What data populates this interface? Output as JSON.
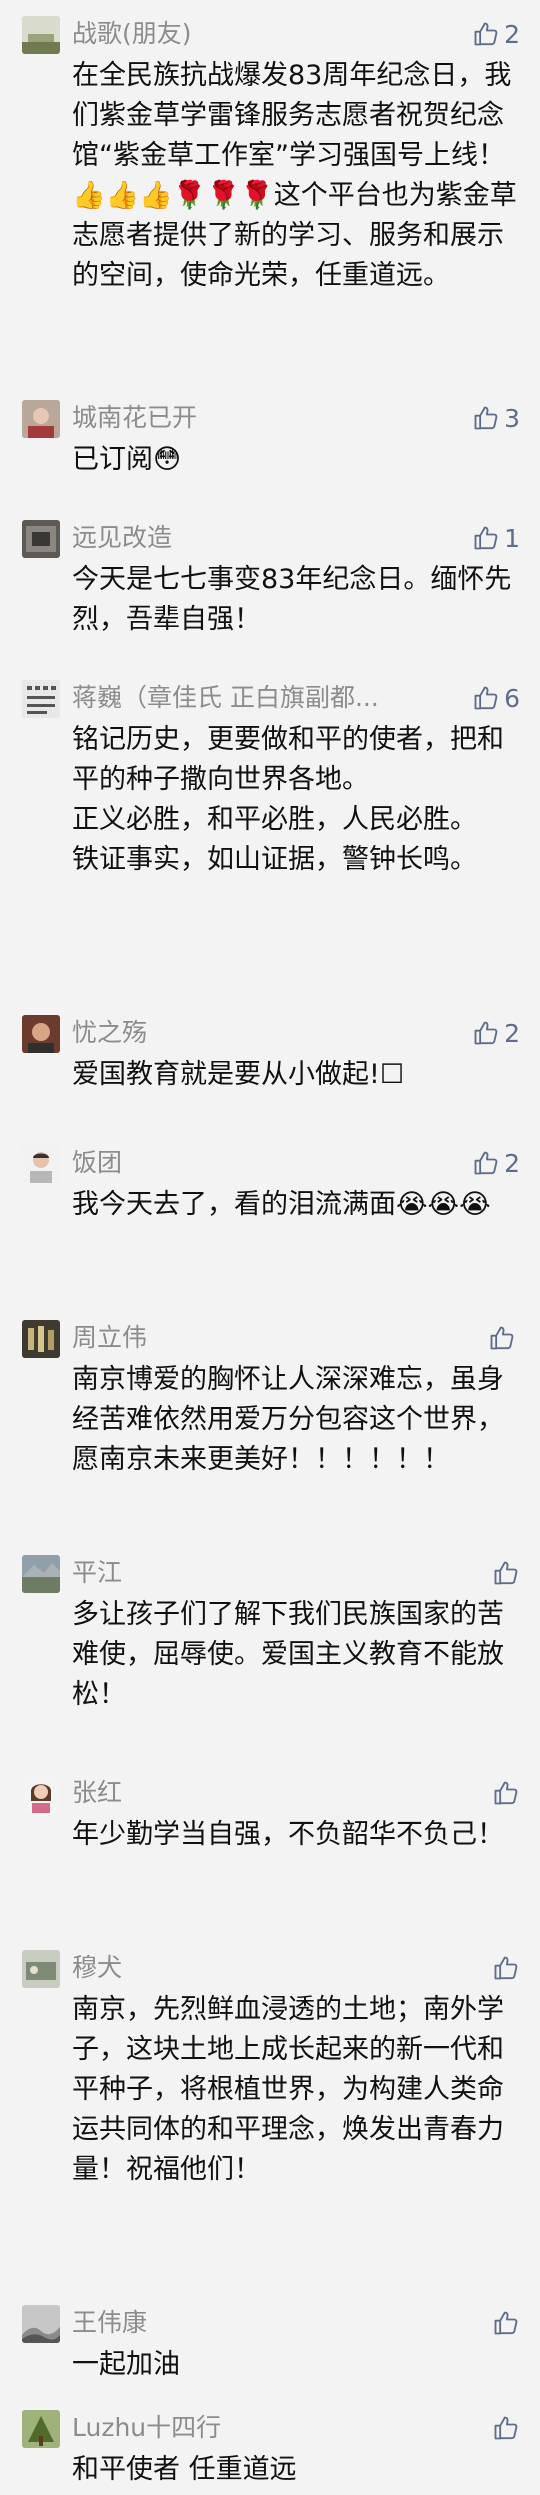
{
  "comments": [
    {
      "name": "战歌(朋友)",
      "likes": "2",
      "text": "在全民族抗战爆发83周年纪念日，我们紫金草学雷锋服务志愿者祝贺纪念馆“紫金草工作室”学习强国号上线！👍👍👍🌹🌹🌹这个平台也为紫金草志愿者提供了新的学习、服务和展示的空间，使命光荣，任重道远。"
    },
    {
      "name": "城南花已开",
      "likes": "3",
      "text": "已订阅😳"
    },
    {
      "name": "远见改造",
      "likes": "1",
      "text": "今天是七七事变83年纪念日。缅怀先烈，吾辈自强！"
    },
    {
      "name": "蒋巍（章佳氏 正白旗副都...",
      "likes": "6",
      "text": "铭记历史，更要做和平的使者，把和平的种子撒向世界各地。\n正义必胜，和平必胜，人民必胜。\n铁证事实，如山证据，警钟长鸣。"
    },
    {
      "name": "忧之殇",
      "likes": "2",
      "text": "爱国教育就是要从小做起!☐"
    },
    {
      "name": "饭团",
      "likes": "2",
      "text": "我今天去了，看的泪流满面😭😭😭"
    },
    {
      "name": "周立伟",
      "likes": "",
      "text": "南京博爱的胸怀让人深深难忘，虽身经苦难依然用爱万分包容这个世界，愿南京未来更美好！！！！！！"
    },
    {
      "name": "平江",
      "likes": "",
      "text": "多让孩子们了解下我们民族国家的苦难使，屈辱使。爱国主义教育不能放松！"
    },
    {
      "name": "张红",
      "likes": "",
      "text": "年少勤学当自强，不负韶华不负己！"
    },
    {
      "name": "穆犬",
      "likes": "",
      "text": "南京，先烈鲜血浸透的土地；南外学子，这块土地上成长起来的新一代和平种子，将根植世界，为构建人类命运共同体的和平理念，焕发出青春力量！祝福他们！"
    },
    {
      "name": "王伟康",
      "likes": "",
      "text": "一起加油"
    },
    {
      "name": "Luzhu十四行",
      "likes": "",
      "text": "和平使者 任重道远"
    }
  ],
  "icons": {
    "like": "thumbs-up-icon",
    "accent_color": "#5e6d8a"
  }
}
